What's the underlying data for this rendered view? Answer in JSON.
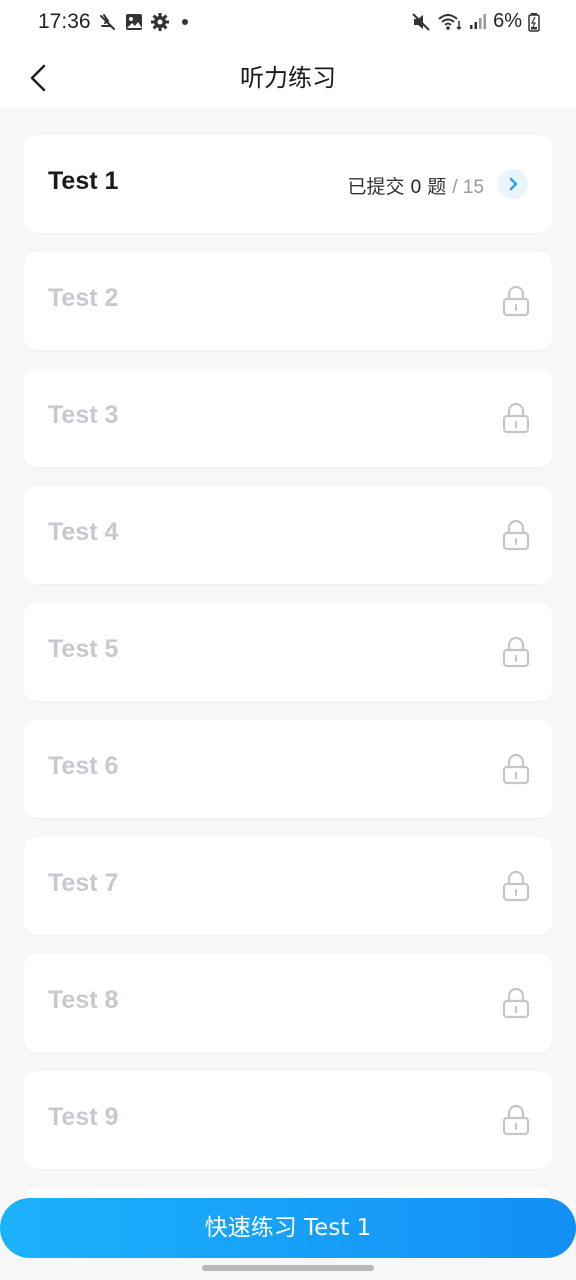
{
  "status_bar": {
    "time": "17:36",
    "battery": "6%"
  },
  "header": {
    "title": "听力练习"
  },
  "tests": [
    {
      "name": "Test 1",
      "unlocked": true,
      "submitted_label": "已提交",
      "submitted": "0",
      "unit": "题",
      "total": "/ 15"
    },
    {
      "name": "Test 2",
      "unlocked": false
    },
    {
      "name": "Test 3",
      "unlocked": false
    },
    {
      "name": "Test 4",
      "unlocked": false
    },
    {
      "name": "Test 5",
      "unlocked": false
    },
    {
      "name": "Test 6",
      "unlocked": false
    },
    {
      "name": "Test 7",
      "unlocked": false
    },
    {
      "name": "Test 8",
      "unlocked": false
    },
    {
      "name": "Test 9",
      "unlocked": false
    }
  ],
  "cta": {
    "label": "快速练习 Test 1"
  },
  "colors": {
    "accent_start": "#1cb2fb",
    "accent_end": "#128ff6",
    "locked_text": "#c7c9ce",
    "chevron": "#2aa7e8"
  }
}
